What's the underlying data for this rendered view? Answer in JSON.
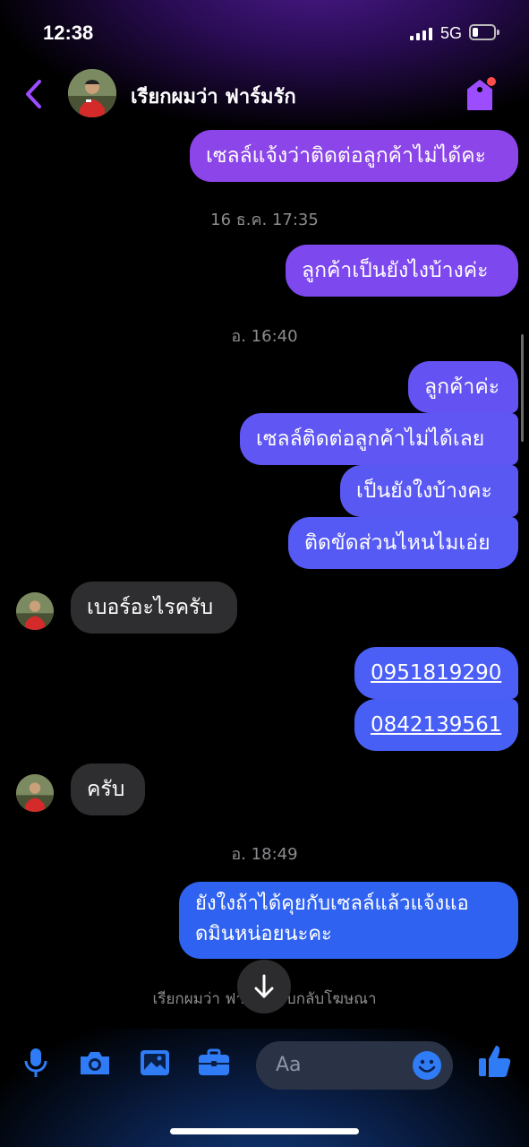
{
  "status_bar": {
    "time": "12:38",
    "network": "5G"
  },
  "header": {
    "contact_name": "เรียกผมว่า ฟาร์มรัก"
  },
  "messages": {
    "m1": "เซลล์แจ้งว่าติดต่อลูกค้าไม่ได้คะ",
    "ts1": "16 ธ.ค. 17:35",
    "m2": "ลูกค้าเป็นยังไงบ้างค่ะ",
    "ts2": "อ. 16:40",
    "m3": "ลูกค้าค่ะ",
    "m4": "เซลล์ติดต่อลูกค้าไม่ได้เลย",
    "m5": "เป็นยังใงบ้างคะ",
    "m6": "ติดขัดส่วนไหนไมเอ่ย",
    "m7": "เบอร์อะไรครับ",
    "m8": "0951819290",
    "m9": "0842139561",
    "m10": "ครับ",
    "ts3": "อ. 18:49",
    "m11_line1": "ยังใงถ้าได้คุยกับเซลล์แล้วแจ้งแอ",
    "m11_line2": "ดมินหน่อยนะคะ"
  },
  "footer_note": "เรียกผมว่า ฟาร์ม   ตอบกลับโฆษณา",
  "composer": {
    "placeholder": "Aa"
  },
  "icons": {
    "back": "chevron-left-icon",
    "tag": "tag-icon",
    "scroll_down": "arrow-down-icon",
    "mic": "microphone-icon",
    "camera": "camera-icon",
    "gallery": "image-icon",
    "briefcase": "briefcase-icon",
    "emoji": "smiley-icon",
    "like": "thumbs-up-icon"
  },
  "colors": {
    "accent": "#8a3ffc",
    "bubble_purple": "#8b45e8",
    "bubble_violet": "#5a55f0",
    "bubble_blue": "#2f62f0",
    "incoming": "#2e2e30",
    "notification_dot": "#ff4d4d"
  }
}
